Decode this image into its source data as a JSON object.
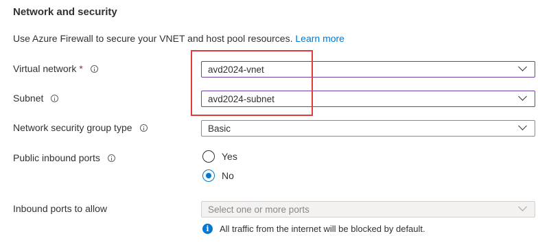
{
  "section": {
    "title": "Network and security",
    "description": "Use Azure Firewall to secure your VNET and host pool resources.",
    "learn_more": "Learn more"
  },
  "fields": {
    "virtual_network": {
      "label": "Virtual network",
      "required_mark": "*",
      "value": "avd2024-vnet"
    },
    "subnet": {
      "label": "Subnet",
      "value": "avd2024-subnet"
    },
    "nsg_type": {
      "label": "Network security group type",
      "value": "Basic"
    },
    "public_inbound_ports": {
      "label": "Public inbound ports",
      "options": [
        "Yes",
        "No"
      ],
      "selected": "No"
    },
    "inbound_ports_to_allow": {
      "label": "Inbound ports to allow",
      "placeholder": "Select one or more ports"
    }
  },
  "notice": {
    "icon_glyph": "i",
    "text": "All traffic from the internet will be blocked by default."
  },
  "colors": {
    "link": "#0078d4",
    "focus_border": "#6b3f9b",
    "highlight": "#e03b3b",
    "required": "#a4262c"
  }
}
